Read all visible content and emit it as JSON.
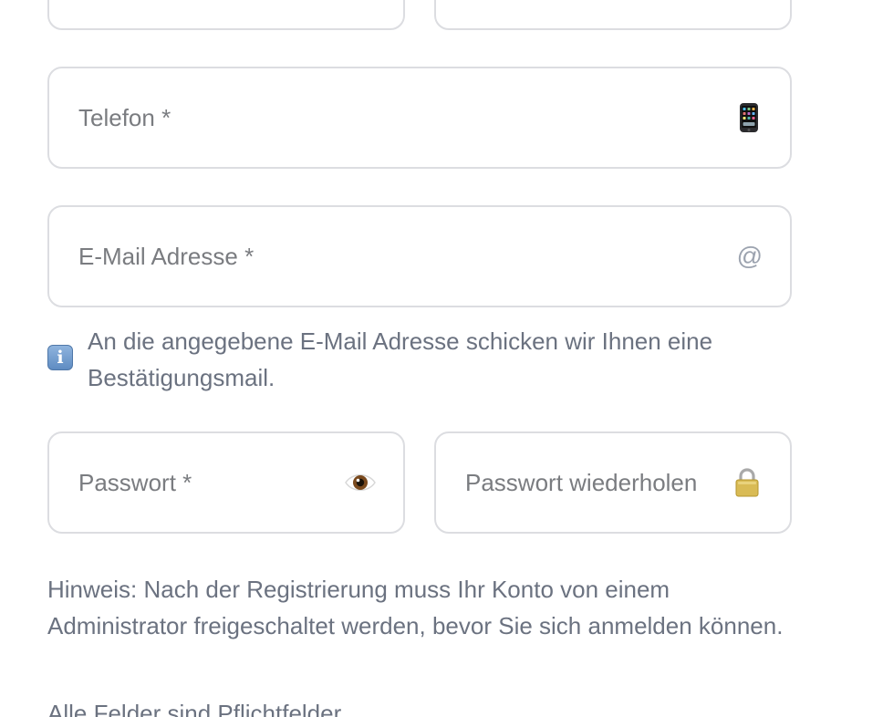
{
  "form": {
    "phone": {
      "placeholder": "Telefon *",
      "value": "",
      "icon": "mobile-phone-icon"
    },
    "email": {
      "placeholder": "E-Mail Adresse *",
      "value": "",
      "icon": "at-sign-icon",
      "icon_glyph": "@"
    },
    "email_info": {
      "icon": "info-icon",
      "icon_glyph": "i",
      "text": "An die angegebene E-Mail Adresse schicken wir Ihnen eine Bestätigungsmail."
    },
    "password": {
      "placeholder": "Passwort *",
      "value": "",
      "icon": "eye-icon"
    },
    "password_repeat": {
      "placeholder": "Passwort wiederholen *",
      "value": "",
      "icon": "lock-icon"
    },
    "hint": "Hinweis: Nach der Registrierung muss Ihr Konto von einem Administrator freigeschaltet werden, bevor Sie sich anmelden können.",
    "required_note": "Alle Felder sind Pflichtfelder"
  },
  "colors": {
    "border": "#dcdde1",
    "text": "#6b7280",
    "placeholder": "#7a7c80",
    "info_blue": "#5f8cc2"
  }
}
